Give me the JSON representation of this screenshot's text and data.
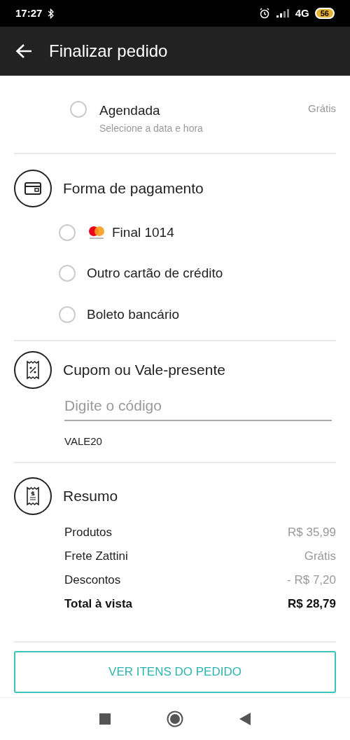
{
  "status_bar": {
    "time": "17:27",
    "network": "4G",
    "battery": "56"
  },
  "app_bar": {
    "title": "Finalizar pedido"
  },
  "delivery_option": {
    "label": "Agendada",
    "sublabel": "Selecione a data e hora",
    "price": "Grátis",
    "selected": false
  },
  "payment": {
    "title": "Forma de pagamento",
    "options": [
      {
        "kind": "card",
        "label": "Final 1014",
        "selected": false
      },
      {
        "kind": "plain",
        "label": "Outro cartão de crédito",
        "selected": false
      },
      {
        "kind": "plain",
        "label": "Boleto bancário",
        "selected": false
      }
    ]
  },
  "coupon": {
    "title": "Cupom ou Vale-presente",
    "placeholder": "Digite o código",
    "applied_code": "VALE20"
  },
  "summary": {
    "title": "Resumo",
    "rows": [
      {
        "label": "Produtos",
        "value": "R$ 35,99",
        "total": false
      },
      {
        "label": "Frete Zattini",
        "value": "Grátis",
        "total": false
      },
      {
        "label": "Descontos",
        "value": "- R$ 7,20",
        "total": false
      },
      {
        "label": "Total à vista",
        "value": "R$ 28,79",
        "total": true
      }
    ]
  },
  "button": {
    "label": "VER ITENS DO PEDIDO"
  }
}
